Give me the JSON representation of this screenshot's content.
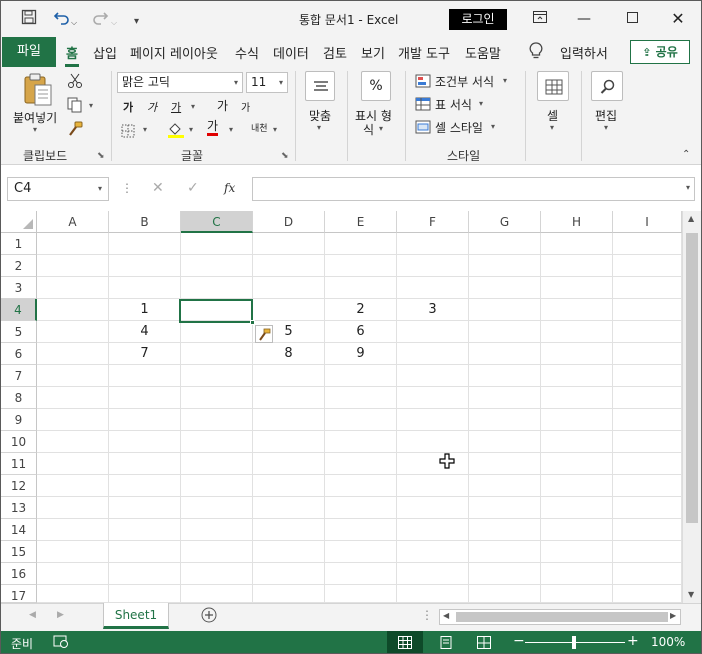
{
  "app": {
    "title": "통합 문서1  -  Excel",
    "login_label": "로그인"
  },
  "tabs": {
    "file": "파일",
    "items": [
      "홈",
      "삽입",
      "페이지 레이아웃",
      "수식",
      "데이터",
      "검토",
      "보기",
      "개발 도구",
      "도움말"
    ],
    "active": "홈",
    "tell_me": "입력하서",
    "share": "공유"
  },
  "ribbon": {
    "paste_label": "붙여넣기",
    "clipboard_group": "클립보드",
    "font_name": "맑은 고딕",
    "font_size": "11",
    "font_group": "글꼴",
    "bold": "가",
    "italic": "가",
    "underline": "가",
    "grow_font": "가",
    "shrink_font": "가",
    "font_color": "가",
    "phonetic": "내천",
    "align_label": "맞춤",
    "number_label_1": "표시 형",
    "number_label_2": "식",
    "conditional_format": "조건부 서식",
    "table_format": "표 서식",
    "cell_styles": "셀 스타일",
    "styles_group": "스타일",
    "cells_label": "셀",
    "editing_label": "편집"
  },
  "formula_bar": {
    "name_box": "C4",
    "fx": "fx",
    "formula": ""
  },
  "grid": {
    "columns": [
      "A",
      "B",
      "C",
      "D",
      "E",
      "F",
      "G",
      "H",
      "I"
    ],
    "selected_column": "C",
    "rows": [
      "1",
      "2",
      "3",
      "4",
      "5",
      "6",
      "7",
      "8",
      "9",
      "10",
      "11",
      "12",
      "13",
      "14",
      "15",
      "16",
      "17"
    ],
    "selected_row": "4",
    "cells": [
      {
        "ref": "B4",
        "value": "1"
      },
      {
        "ref": "E4",
        "value": "2"
      },
      {
        "ref": "F4",
        "value": "3"
      },
      {
        "ref": "B5",
        "value": "4"
      },
      {
        "ref": "D5",
        "value": "5"
      },
      {
        "ref": "E5",
        "value": "6"
      },
      {
        "ref": "B6",
        "value": "7"
      },
      {
        "ref": "D6",
        "value": "8"
      },
      {
        "ref": "E6",
        "value": "9"
      }
    ],
    "active_cell": "C4"
  },
  "sheets": {
    "tabs": [
      "Sheet1"
    ],
    "active": "Sheet1"
  },
  "status": {
    "ready": "준비",
    "zoom": "100%"
  },
  "colors": {
    "accent": "#217346",
    "ribbon_bg": "#f3f3f3",
    "gridline": "#e1e1e1",
    "header_selected": "#d2d2d2",
    "font_color_bar": "#e00000",
    "fill_color_bar": "#ffff00"
  }
}
